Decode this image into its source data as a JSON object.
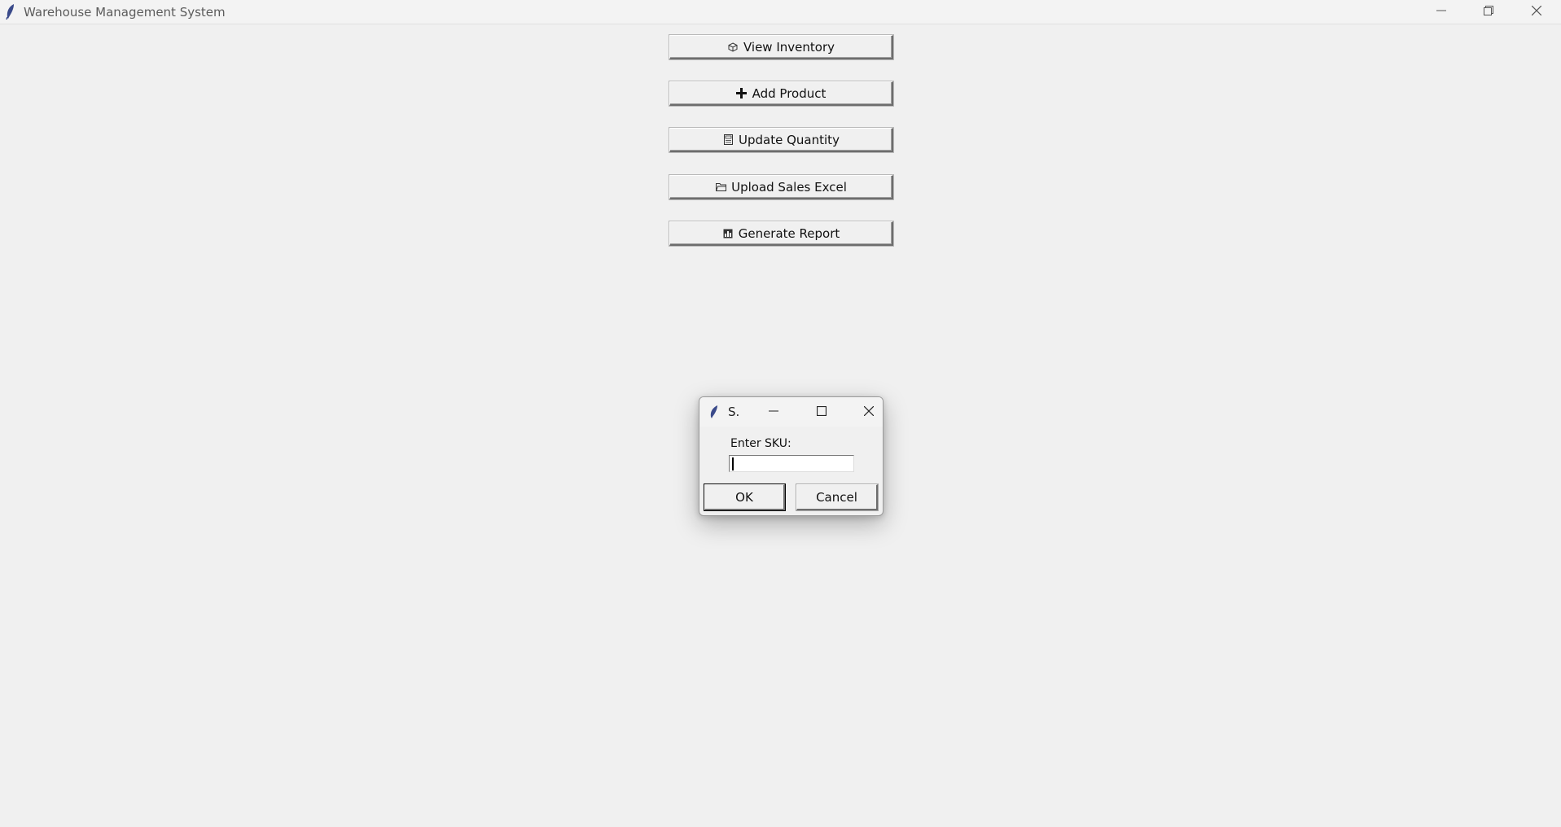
{
  "window": {
    "title": "Warehouse Management System",
    "icon": "feather-icon",
    "controls": {
      "minimize": "minimize-icon",
      "restore": "restore-icon",
      "close": "close-icon"
    }
  },
  "main": {
    "buttons": [
      {
        "label": "View Inventory",
        "icon": "package-icon",
        "glyph": "📦"
      },
      {
        "label": "Add Product",
        "icon": "plus-icon",
        "glyph": "✚"
      },
      {
        "label": "Update Quantity",
        "icon": "calculator-icon",
        "glyph": "▣"
      },
      {
        "label": "Upload Sales Excel",
        "icon": "folder-icon",
        "glyph": "🗀"
      },
      {
        "label": "Generate Report",
        "icon": "chart-icon",
        "glyph": "▦"
      }
    ]
  },
  "dialog": {
    "title": "S.",
    "icon": "feather-icon",
    "prompt": "Enter SKU:",
    "input_value": "",
    "ok_label": "OK",
    "cancel_label": "Cancel"
  }
}
